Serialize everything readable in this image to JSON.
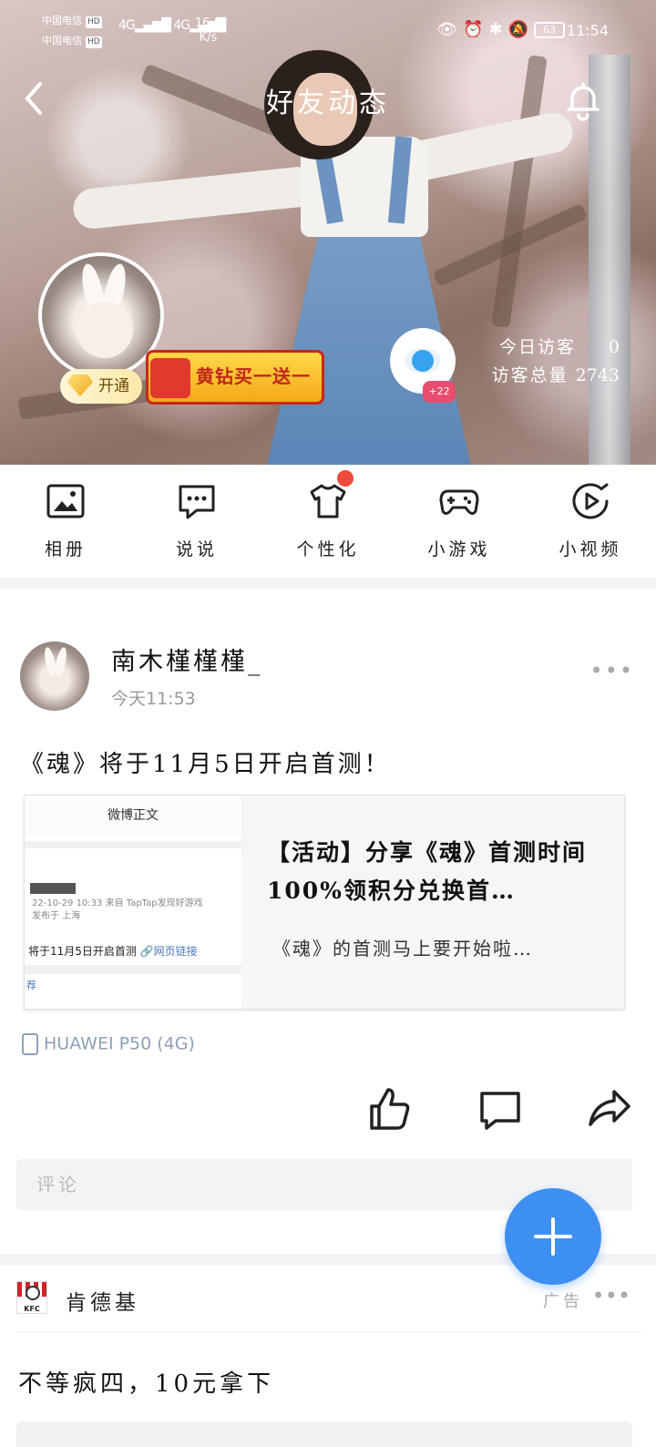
{
  "status": {
    "carrier1": "中国电信",
    "carrier2": "中国电信",
    "hd": "HD",
    "signal": "4G",
    "speed": "16.6",
    "speed_unit": "K/s",
    "battery": "63",
    "time": "11:54"
  },
  "header": {
    "title": "好友动态"
  },
  "profile": {
    "vip_label": "开通",
    "promo_text": "黄钻买一送一",
    "visitor_badge": "+22",
    "today_visitors_label": "今日访客",
    "today_visitors": "0",
    "total_visitors_label": "访客总量",
    "total_visitors": "2743"
  },
  "quicknav": {
    "items": [
      {
        "label": "相册",
        "icon": "album-icon"
      },
      {
        "label": "说说",
        "icon": "chat-icon"
      },
      {
        "label": "个性化",
        "icon": "tshirt-icon"
      },
      {
        "label": "小游戏",
        "icon": "gamepad-icon"
      },
      {
        "label": "小视频",
        "icon": "video-icon"
      }
    ]
  },
  "post": {
    "author": "南木槿槿槿_",
    "time": "今天11:53",
    "text": "《魂》将于11月5日开启首测！",
    "link": {
      "thumb_header": "微博正文",
      "thumb_meta1": "22-10-29 10:33  来自 TapTap发现好游戏",
      "thumb_meta2": "发布于 上海",
      "thumb_line": "将于11月5日开启首测",
      "thumb_link": "🔗网页链接",
      "thumb_rec": "荐",
      "title": "【活动】分享《魂》首测时间 100%领积分兑换首…",
      "desc": "《魂》的首测马上要开始啦…"
    },
    "device": "HUAWEI P50 (4G)",
    "comment_placeholder": "评论"
  },
  "ad": {
    "brand": "肯德基",
    "logo_text": "KFC",
    "tag": "广告",
    "text": "不等疯四，10元拿下"
  },
  "colors": {
    "accent": "#3d8ff1",
    "red_dot": "#f04a3a",
    "device_text": "#8fa0b8"
  }
}
